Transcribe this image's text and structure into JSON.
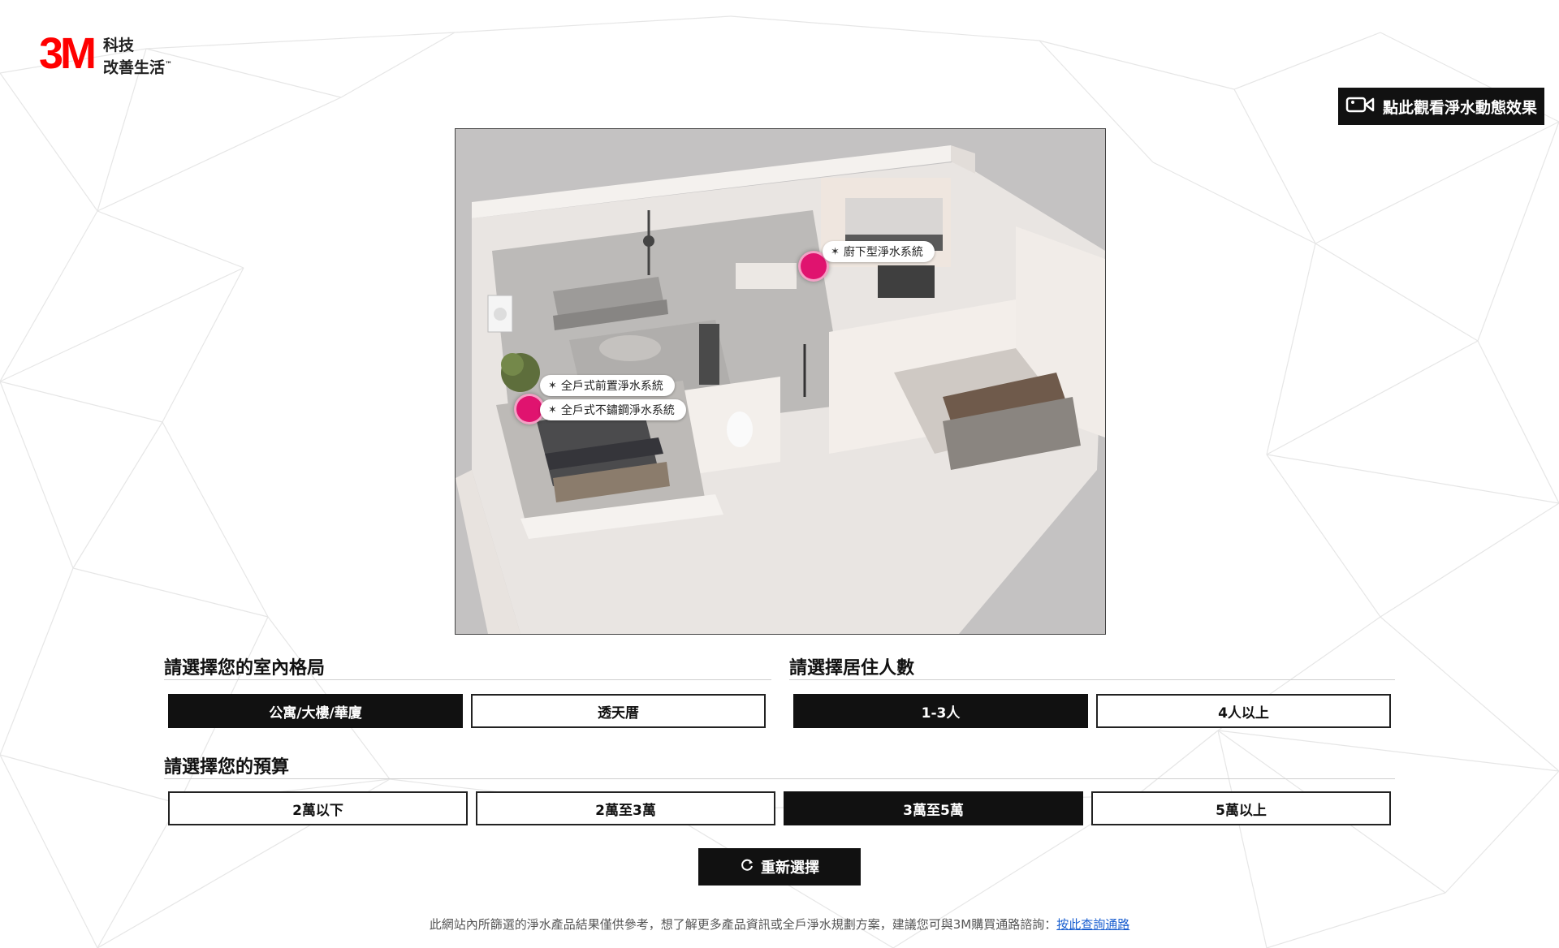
{
  "brand": {
    "logo_text": "3M",
    "tagline_line1": "科技",
    "tagline_line2": "改善生活",
    "tm": "™"
  },
  "video_button": {
    "label": "點此觀看淨水動態效果",
    "icon": "video-camera-icon"
  },
  "scene": {
    "hotspots": [
      {
        "label": "廚下型淨水系統"
      },
      {
        "label": "全戶式前置淨水系統"
      },
      {
        "label": "全戶式不鏽鋼淨水系統"
      }
    ],
    "hotspot_icon": "sparkle-icon",
    "hotspot_color": "#e0136f"
  },
  "layout_section": {
    "title": "請選擇您的室內格局",
    "options": [
      "公寓/大樓/華廈",
      "透天厝"
    ],
    "selected": "公寓/大樓/華廈"
  },
  "residents_section": {
    "title": "請選擇居住人數",
    "options": [
      "1-3人",
      "4人以上"
    ],
    "selected": "1-3人"
  },
  "budget_section": {
    "title": "請選擇您的預算",
    "options": [
      "2萬以下",
      "2萬至3萬",
      "3萬至5萬",
      "5萬以上"
    ],
    "selected": "3萬至5萬"
  },
  "reset_button": {
    "label": "重新選擇",
    "icon": "refresh-icon"
  },
  "footer": {
    "text": "此網站內所篩選的淨水產品結果僅供參考，想了解更多產品資訊或全戶淨水規劃方案，建議您可與3M購買通路諮詢：",
    "link": "按此查詢通路"
  },
  "colors": {
    "brand_red": "#ff0000",
    "selected_bg": "#111111",
    "hotspot": "#e0136f",
    "link": "#1a5fd0"
  }
}
